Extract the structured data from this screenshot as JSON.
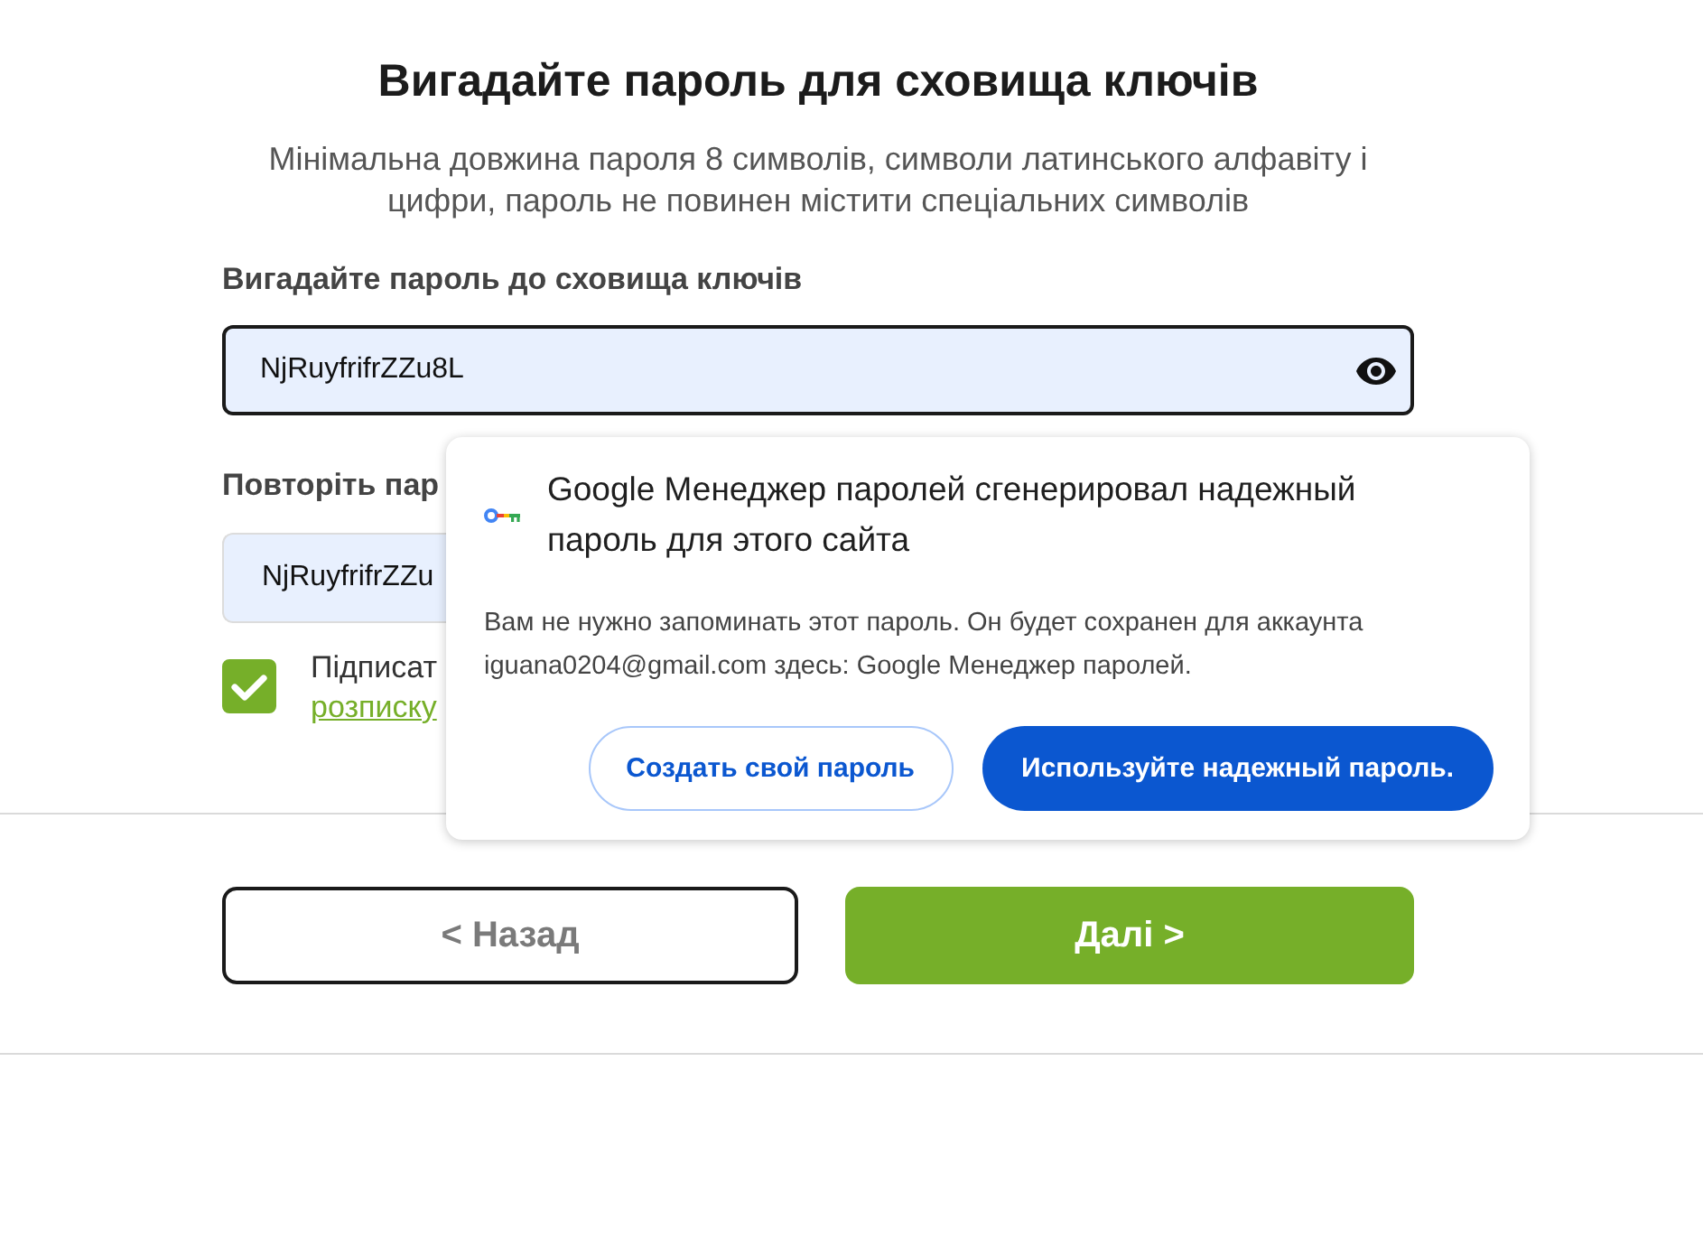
{
  "title": "Вигадайте пароль для сховища ключів",
  "subtitle": "Мінімальна довжина пароля 8 символів, символи латинського алфавіту і цифри, пароль не повинен містити спеціальних символів",
  "password_field": {
    "label": "Вигадайте пароль до сховища ключів",
    "value": "NjRuyfrifrZZu8L"
  },
  "repeat_field": {
    "label": "Повторіть пар",
    "value": "NjRuyfrifrZZu"
  },
  "consent": {
    "checked": true,
    "text": "Підписат",
    "link": "розписку"
  },
  "buttons": [
    {
      "label": "< Назад",
      "kind": "secondary"
    },
    {
      "label": "Далі >",
      "kind": "primary"
    }
  ],
  "password_popup": {
    "title": "Google Менеджер паролей сгенерировал надежный пароль для этого сайта",
    "body": "Вам не нужно запоминать этот пароль. Он будет сохранен для аккаунта iguana0204@gmail.com здесь: Google Менеджер паролей.",
    "buttons": [
      {
        "label": "Создать свой пароль",
        "kind": "secondary"
      },
      {
        "label": "Используйте надежный пароль.",
        "kind": "primary"
      }
    ]
  }
}
